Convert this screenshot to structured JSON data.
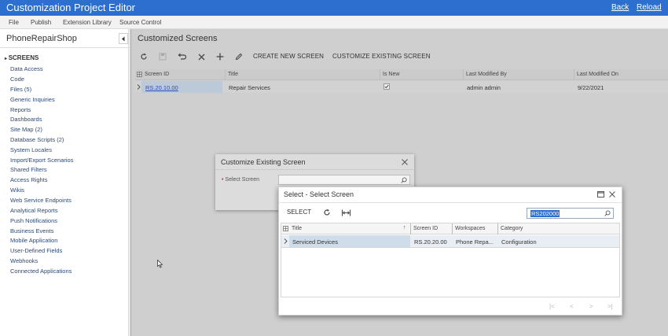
{
  "app": {
    "title": "Customization Project Editor",
    "back_label": "Back",
    "reload_label": "Reload",
    "brand_color": "#2c6fcf"
  },
  "menu": [
    "File",
    "Publish",
    "Extension Library",
    "Source Control"
  ],
  "sidebar": {
    "project_name": "PhoneRepairShop",
    "section": "SCREENS",
    "items": [
      "Data Access",
      "Code",
      "Files (5)",
      "Generic Inquiries",
      "Reports",
      "Dashboards",
      "Site Map (2)",
      "Database Scripts (2)",
      "System Locales",
      "Import/Export Scenarios",
      "Shared Filters",
      "Access Rights",
      "Wikis",
      "Web Service Endpoints",
      "Analytical Reports",
      "Push Notifications",
      "Business Events",
      "Mobile Application",
      "User-Defined Fields",
      "Webhooks",
      "Connected Applications"
    ]
  },
  "main": {
    "title": "Customized Screens",
    "toolbar": {
      "create_label": "CREATE NEW SCREEN",
      "customize_label": "CUSTOMIZE EXISTING SCREEN"
    },
    "grid": {
      "columns": [
        "Screen ID",
        "Title",
        "Is New",
        "Last Modified By",
        "Last Modified On"
      ],
      "rows": [
        {
          "screen_id": "RS.20.10.00",
          "title": "Repair Services",
          "is_new": true,
          "modified_by": "admin admin",
          "modified_on": "9/22/2021"
        }
      ]
    }
  },
  "dialog_customize": {
    "title": "Customize Existing Screen",
    "field_label": "Select Screen"
  },
  "dialog_select": {
    "title": "Select - Select Screen",
    "select_label": "SELECT",
    "search_value": "RS202000",
    "columns": [
      "Title",
      "Screen ID",
      "Workspaces",
      "Category"
    ],
    "rows": [
      {
        "title": "Serviced Devices",
        "screen_id": "RS.20.20.00",
        "workspaces": "Phone Repa...",
        "category": "Configuration"
      }
    ]
  }
}
